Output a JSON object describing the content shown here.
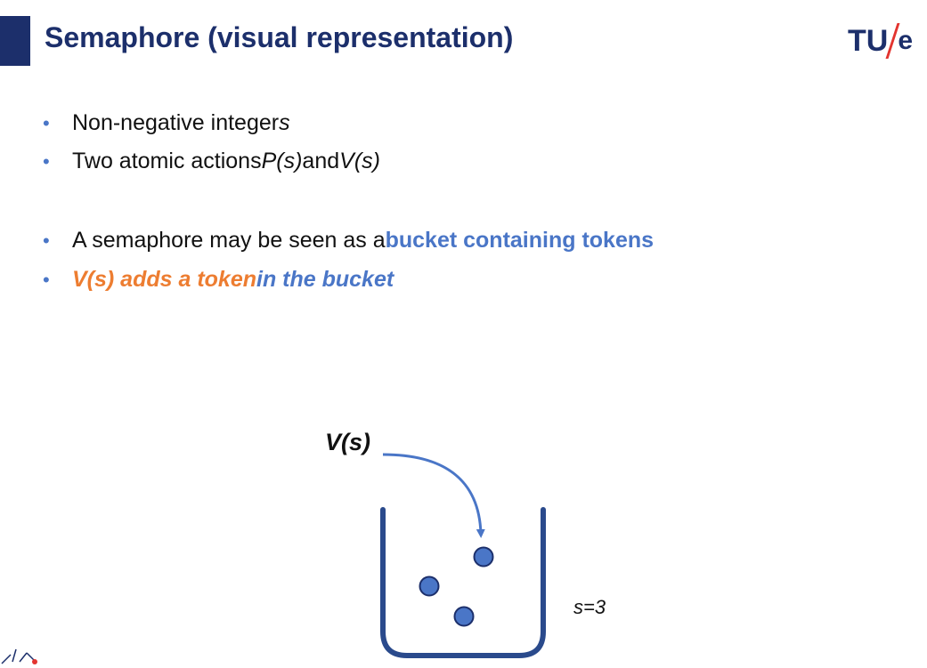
{
  "slide": {
    "title": "Semaphore (visual representation)",
    "logo": {
      "main": "TU",
      "suffix": "e"
    },
    "bullets": [
      {
        "text": "Non-negative integer ",
        "var": "s"
      },
      {
        "pre": "Two atomic actions ",
        "p": "P(s)",
        "mid": " and ",
        "v": "V(s)"
      },
      {
        "pre": "A semaphore may be seen as a ",
        "highlight": "bucket containing tokens"
      },
      {
        "orange": "V(s) adds a token",
        "blue": " in the bucket"
      }
    ]
  },
  "diagram": {
    "action_label": "V(s)",
    "count_label": "s=3",
    "token_count": 3
  },
  "colors": {
    "title": "#1c2f6b",
    "accent_blue": "#4a76c7",
    "accent_orange": "#ed7d31",
    "logo_slash": "#e3342f",
    "bucket": "#2a4a8c",
    "token": "#4a76c7"
  }
}
